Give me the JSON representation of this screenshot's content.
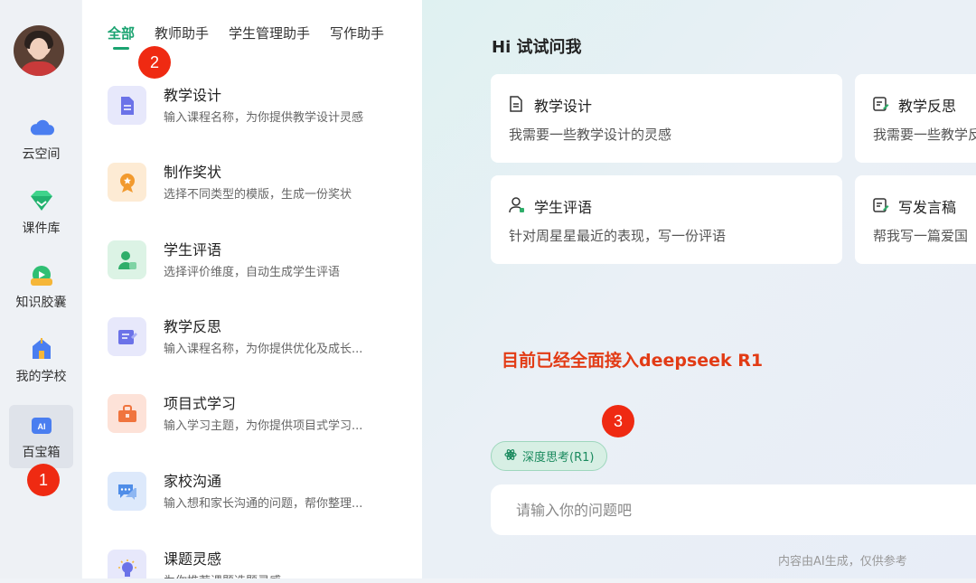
{
  "nav": {
    "items": [
      {
        "label": "云空间",
        "icon": "cloud-icon"
      },
      {
        "label": "课件库",
        "icon": "courseware-icon"
      },
      {
        "label": "知识胶囊",
        "icon": "knowledge-capsule-icon"
      },
      {
        "label": "我的学校",
        "icon": "school-icon"
      },
      {
        "label": "百宝箱",
        "icon": "ai-toolbox-icon",
        "active": true
      }
    ]
  },
  "tabs": [
    {
      "label": "全部",
      "active": true
    },
    {
      "label": "教师助手"
    },
    {
      "label": "学生管理助手"
    },
    {
      "label": "写作助手"
    }
  ],
  "tools": [
    {
      "title": "教学设计",
      "desc": "输入课程名称，为你提供教学设计灵感",
      "icon": "document-icon",
      "color": "#6b72e8",
      "bg": "#e7e8fb"
    },
    {
      "title": "制作奖状",
      "desc": "选择不同类型的模版，生成一份奖状",
      "icon": "award-icon",
      "color": "#f29a2e",
      "bg": "#fdebd4"
    },
    {
      "title": "学生评语",
      "desc": "选择评价维度，自动生成学生评语",
      "icon": "student-icon",
      "color": "#2fae6a",
      "bg": "#dcf3e5"
    },
    {
      "title": "教学反思",
      "desc": "输入课程名称，为你提供优化及成长...",
      "icon": "book-icon",
      "color": "#6b72e8",
      "bg": "#e7e8fb"
    },
    {
      "title": "项目式学习",
      "desc": "输入学习主题，为你提供项目式学习...",
      "icon": "briefcase-icon",
      "color": "#f0743e",
      "bg": "#fde2d8"
    },
    {
      "title": "家校沟通",
      "desc": "输入想和家长沟通的问题，帮你整理...",
      "icon": "chat-icon",
      "color": "#4f8de8",
      "bg": "#dde9fb"
    },
    {
      "title": "课题灵感",
      "desc": "为你推荐课题选题灵感",
      "icon": "lightbulb-icon",
      "color": "#6b72e8",
      "bg": "#e7e8fb"
    }
  ],
  "main": {
    "greeting": "Hi 试试问我",
    "cards": [
      {
        "title": "教学设计",
        "desc": "我需要一些教学设计的灵感",
        "icon": "document-icon"
      },
      {
        "title": "教学反思",
        "desc": "我需要一些教学反思",
        "icon": "edit-note-icon"
      },
      {
        "title": "学生评语",
        "desc": "针对周星星最近的表现，写一份评语",
        "icon": "person-icon"
      },
      {
        "title": "写发言稿",
        "desc": "帮我写一篇爱国",
        "icon": "edit-note-icon"
      }
    ],
    "notice": "目前已经全面接入deepseek R1",
    "deep_think_label": "深度思考(R1)",
    "input_placeholder": "请输入你的问题吧",
    "disclaimer": "内容由AI生成，仅供参考"
  },
  "markers": [
    "1",
    "2",
    "3"
  ],
  "colors": {
    "accent": "#1aa370",
    "marker": "#ef2a12",
    "notice": "#e23b15"
  }
}
